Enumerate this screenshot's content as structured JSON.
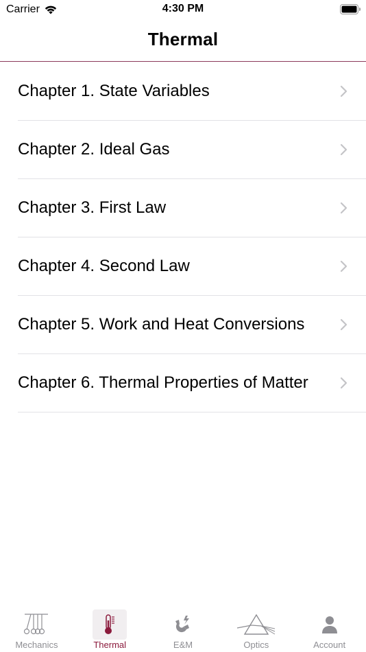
{
  "status_bar": {
    "carrier": "Carrier",
    "time": "4:30 PM"
  },
  "nav": {
    "title": "Thermal"
  },
  "chapters": [
    {
      "label": "Chapter 1. State Variables"
    },
    {
      "label": "Chapter 2. Ideal Gas"
    },
    {
      "label": "Chapter 3. First Law"
    },
    {
      "label": "Chapter 4. Second Law"
    },
    {
      "label": "Chapter 5. Work and Heat Conversions"
    },
    {
      "label": "Chapter 6. Thermal Properties of Matter"
    }
  ],
  "tabs": [
    {
      "label": "Mechanics",
      "icon": "pendulum-icon"
    },
    {
      "label": "Thermal",
      "icon": "thermometer-icon",
      "active": true
    },
    {
      "label": "E&M",
      "icon": "magnet-icon"
    },
    {
      "label": "Optics",
      "icon": "prism-icon"
    },
    {
      "label": "Account",
      "icon": "person-icon"
    }
  ],
  "colors": {
    "accent": "#8b1a3c",
    "inactive": "#8e8e93",
    "separator": "#e2e2e6"
  }
}
